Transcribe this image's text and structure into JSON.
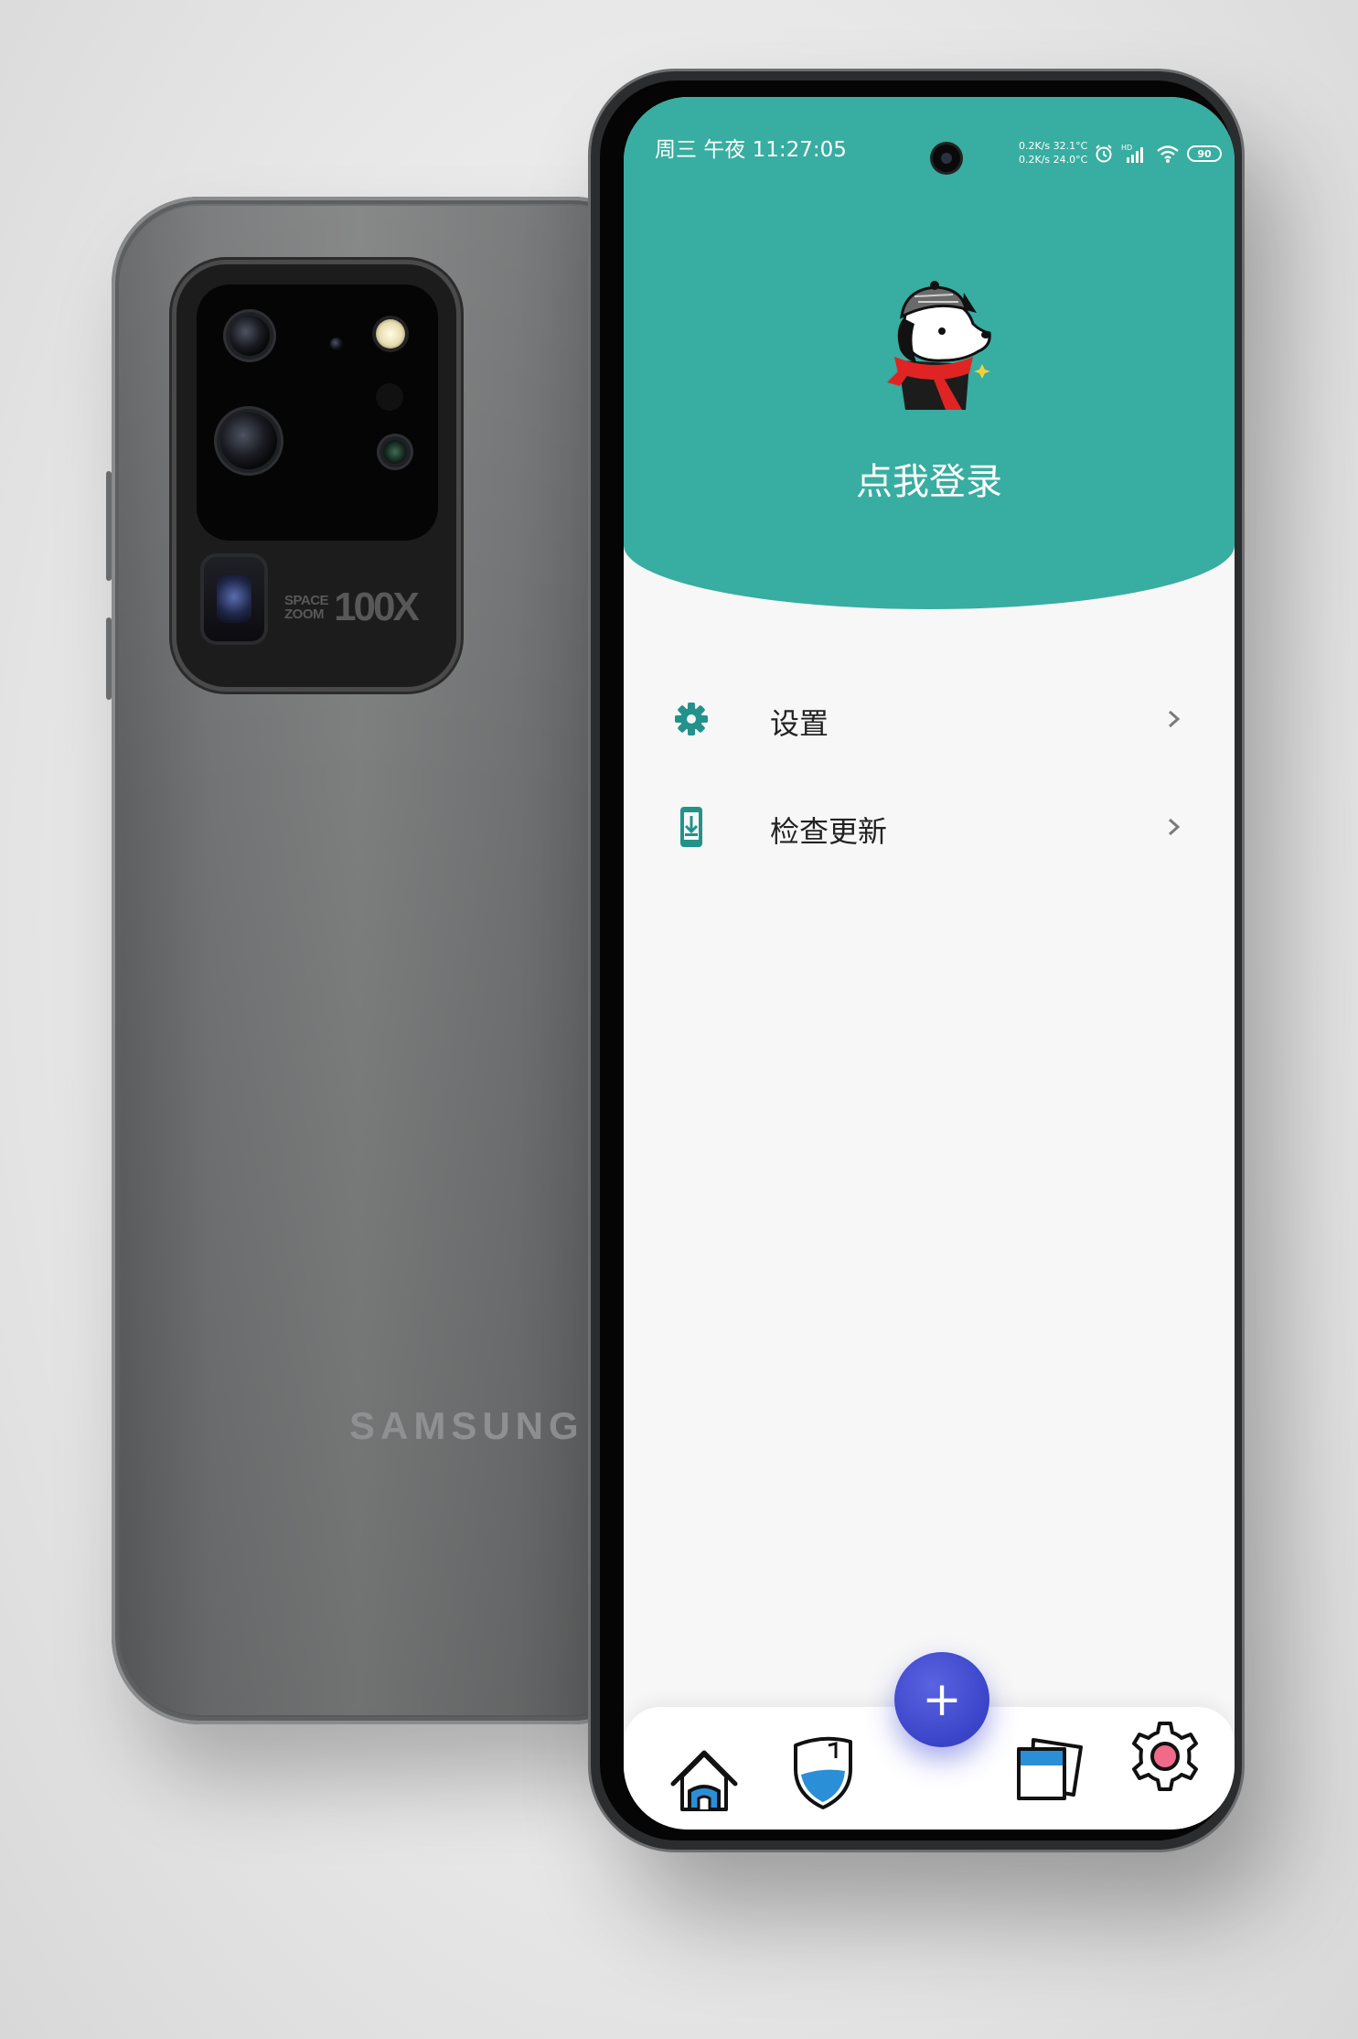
{
  "device": {
    "back_brand": "SAMSUNG",
    "camera_zoom_label_top": "SPACE",
    "camera_zoom_label_bottom": "ZOOM",
    "camera_zoom_value": "100X"
  },
  "status_bar": {
    "time": "周三 午夜 11:27:05",
    "net_speed_up": "0.2K/s 32.1°C",
    "net_speed_down": "0.2K/s 24.0°C",
    "battery": "90",
    "icons": [
      "alarm-icon",
      "hd-signal-icon",
      "wifi-icon",
      "battery-icon"
    ]
  },
  "header": {
    "background_color": "#38ada1",
    "avatar": "dog-avatar-icon",
    "login_label": "点我登录"
  },
  "menu": {
    "items": [
      {
        "label": "设置",
        "icon": "gear-icon"
      },
      {
        "label": "检查更新",
        "icon": "phone-download-icon"
      }
    ]
  },
  "bottom_nav": {
    "items": [
      "home-icon",
      "shield-icon",
      "add-button",
      "cards-icon",
      "settings-gear-icon"
    ],
    "fab_label": "+",
    "fab_color": "#3a44c8"
  }
}
